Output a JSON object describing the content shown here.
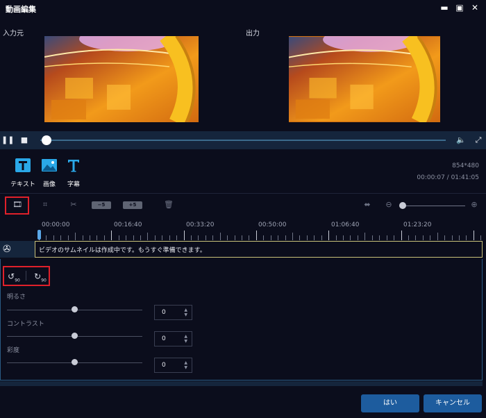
{
  "window": {
    "title": "動画編集"
  },
  "preview": {
    "input_label": "入力元",
    "output_label": "出力"
  },
  "tools": [
    {
      "label": "テキスト",
      "icon": "text-tool-icon"
    },
    {
      "label": "画像",
      "icon": "image-tool-icon"
    },
    {
      "label": "字幕",
      "icon": "subtitle-tool-icon"
    }
  ],
  "info": {
    "resolution": "854*480",
    "time": "00:00:07 / 01:41:05"
  },
  "timeline": {
    "badge_minus": "−5",
    "badge_plus": "+5",
    "ruler": [
      "00:00:00",
      "00:16:40",
      "00:33:20",
      "00:50:00",
      "01:06:40",
      "01:23:20"
    ],
    "track_message": "ビデオのサムネイルは作成中です。もうすぐ準備できます。"
  },
  "adjust": {
    "rotate_left": "90",
    "rotate_right": "90",
    "items": [
      {
        "label": "明るさ",
        "value": "0"
      },
      {
        "label": "コントラスト",
        "value": "0"
      },
      {
        "label": "彩度",
        "value": "0"
      }
    ]
  },
  "buttons": {
    "ok": "はい",
    "cancel": "キャンセル"
  },
  "colors": {
    "accent": "#1d5c9e",
    "highlight": "#e0202a",
    "playbar": "#15253c"
  }
}
